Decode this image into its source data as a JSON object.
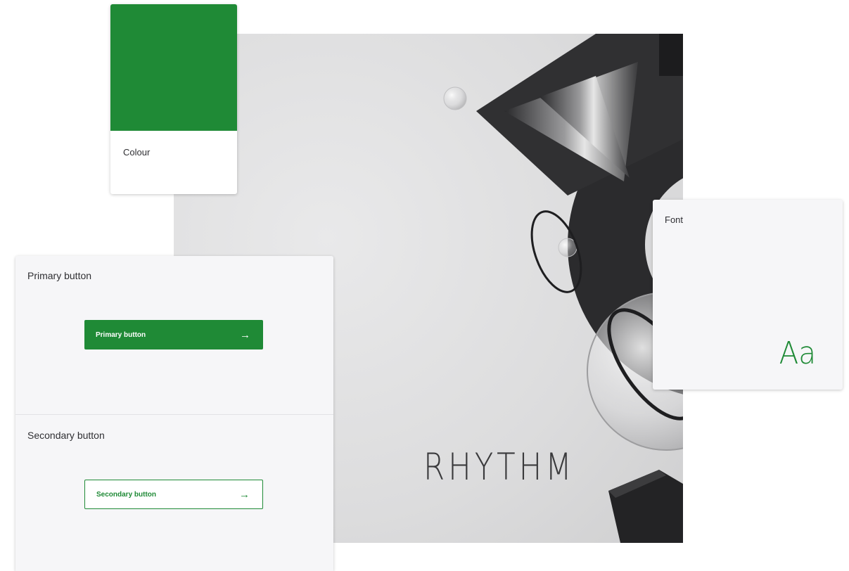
{
  "hero": {
    "word": "RHYTHM"
  },
  "colour_card": {
    "label": "Colour",
    "swatch_color": "#1f8a36"
  },
  "font_card": {
    "label": "Font",
    "sample": "Aa",
    "sample_color": "#1f8a36"
  },
  "buttons_panel": {
    "primary": {
      "title": "Primary button",
      "button_label": "Primary button",
      "arrow": "→",
      "color": "#1f8a36"
    },
    "secondary": {
      "title": "Secondary button",
      "button_label": "Secondary button",
      "arrow": "→",
      "color": "#1f8a36"
    }
  }
}
